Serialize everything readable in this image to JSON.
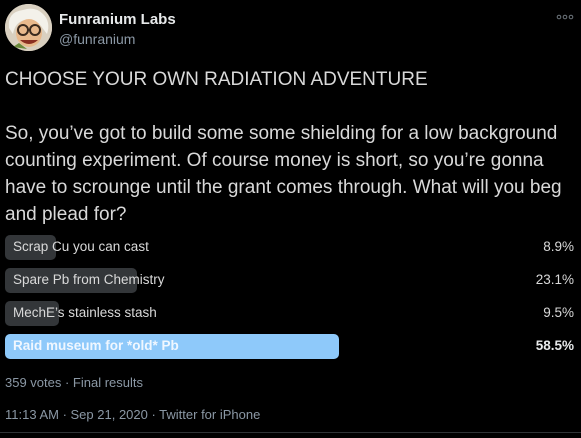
{
  "author": {
    "name": "Funranium Labs",
    "handle": "@funranium",
    "avatar_icon": "cartoon-scientist-avatar"
  },
  "more_icon": "ellipsis-icon",
  "tweet": {
    "text": "CHOOSE YOUR OWN RADIATION ADVENTURE\n\nSo, you’ve got to build some some shielding for a low background counting experiment. Of course money is short, so you’re gonna have to scrounge until the grant comes through. What will you beg and plead for?"
  },
  "poll": {
    "options": [
      {
        "label": "Scrap Cu you can cast",
        "percent_text": "8.9%",
        "percent": 8.9,
        "winner": false
      },
      {
        "label": "Spare Pb from Chemistry",
        "percent_text": "23.1%",
        "percent": 23.1,
        "winner": false
      },
      {
        "label": "MechE’s stainless stash",
        "percent_text": "9.5%",
        "percent": 9.5,
        "winner": false
      },
      {
        "label": "Raid museum for *old* Pb",
        "percent_text": "58.5%",
        "percent": 58.5,
        "winner": true
      }
    ],
    "votes_text": "359 votes · Final results"
  },
  "meta": {
    "timestamp_text": "11:13 AM · Sep 21, 2020 · Twitter for iPhone"
  },
  "colors": {
    "background": "#000000",
    "bar": "#333639",
    "winner_bar": "#8ec9fa",
    "secondary_text": "#8b98a5"
  }
}
